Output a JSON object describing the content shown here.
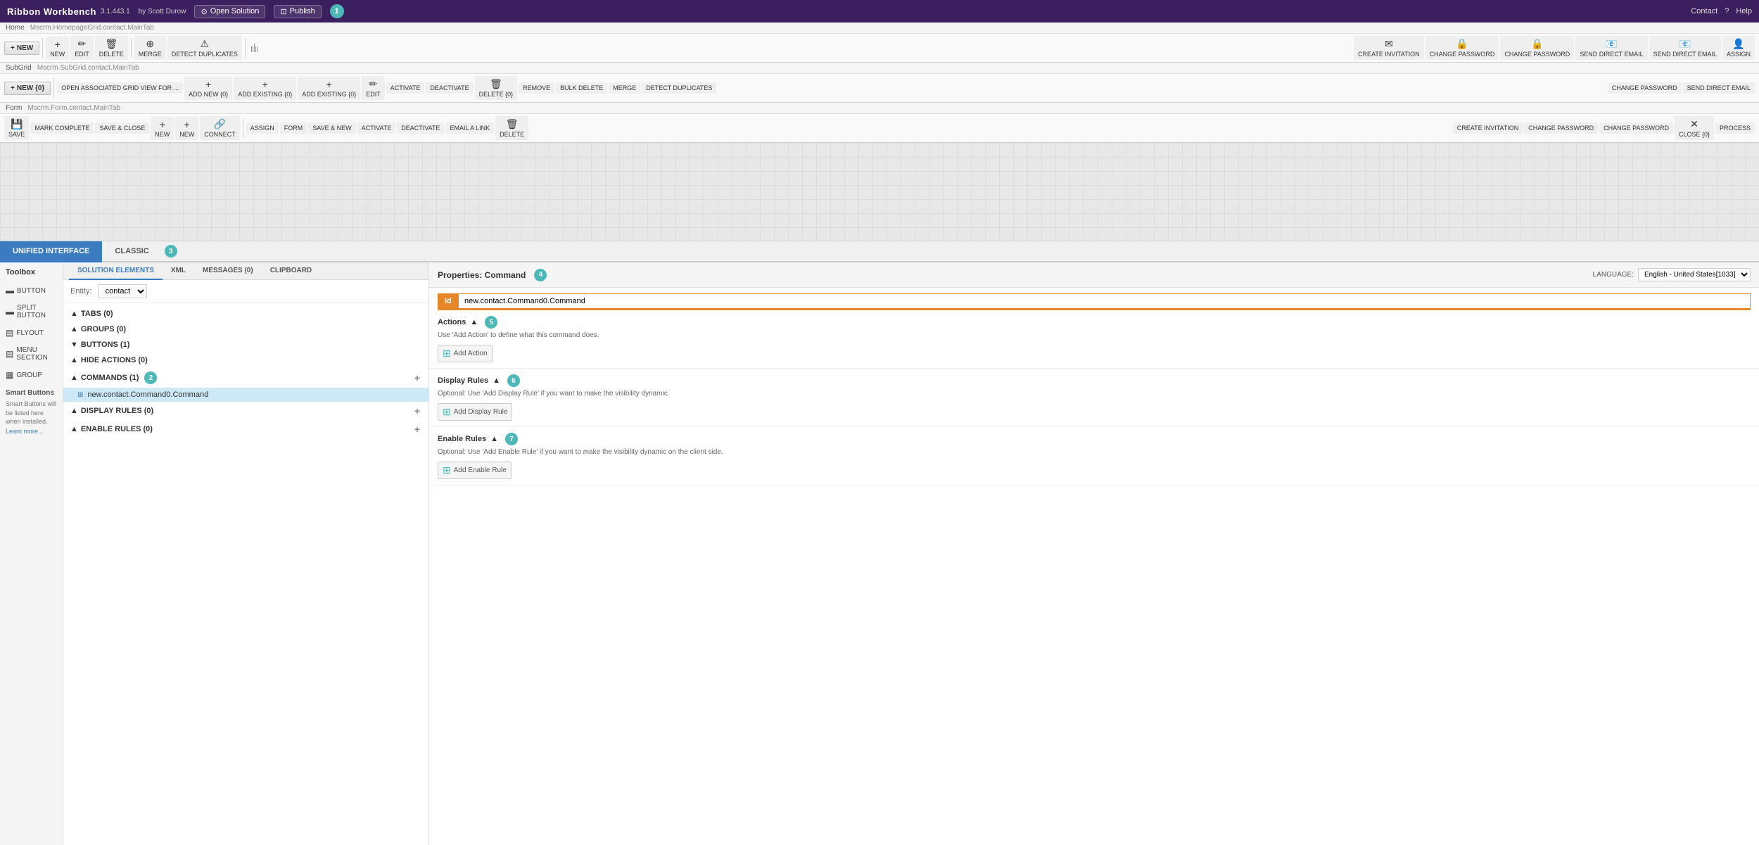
{
  "topbar": {
    "app_name": "Ribbon Workbench",
    "version": "3.1.443.1",
    "author": "by Scott Durow",
    "open_solution_label": "Open Solution",
    "publish_label": "Publish",
    "badge_num": "1",
    "contact_label": "Contact",
    "help_label": "Help"
  },
  "ribbon1": {
    "label": "Home",
    "path": "Mscrm.HomepageGrid.contact.MainTab",
    "buttons": [
      "NEW",
      "NEW",
      "EDIT",
      "DELETE",
      "MERGE",
      "DETECT DUPLICATES",
      "CREATE INVITATION",
      "CHANGE PASSWORD",
      "CHANGE PASSWORD",
      "SEND DIRECT EMAIL",
      "SEND DIRECT EMAIL",
      "ASSIGN"
    ]
  },
  "ribbon2": {
    "label": "SubGrid",
    "path": "Mscrm.SubGrid.contact.MainTab",
    "buttons": [
      "NEW {0}",
      "OPEN ASSOCIATED GRID VIEW FOR ...",
      "ADD NEW {0}",
      "ADD EXISTING {0}",
      "ADD EXISTING {0}",
      "EDIT",
      "ACTIVATE",
      "DEACTIVATE",
      "DELETE {0}",
      "REMOVE",
      "BULK DELETE",
      "MERGE",
      "DETECT DUPLICATES",
      "CHANGE PASSWORD",
      "SEND DIRECT EMAIL"
    ]
  },
  "ribbon3": {
    "label": "Form",
    "path": "Mscrm.Form.contact.MainTab",
    "buttons": [
      "SAVE",
      "MARK COMPLETE",
      "SAVE & CLOSE",
      "NEW",
      "NEW",
      "CONNECT",
      "ASSIGN",
      "FORM",
      "SAVE & NEW",
      "ACTIVATE",
      "DEACTIVATE",
      "EMAIL A LINK",
      "DELETE",
      "CREATE INVITATION",
      "CHANGE PASSWORD",
      "CHANGE PASSWORD",
      "CLOSE {0}",
      "PROCESS"
    ]
  },
  "tabs": {
    "unified_interface": "UNIFIED INTERFACE",
    "classic": "CLASSIC"
  },
  "left_panel": {
    "toolbox_title": "Toolbox",
    "items": [
      {
        "id": "button",
        "label": "BUTTON",
        "icon": "▬"
      },
      {
        "id": "split_button",
        "label": "SPLIT BUTTON",
        "icon": "▬▼"
      },
      {
        "id": "flyout",
        "label": "FLYOUT",
        "icon": "▤"
      },
      {
        "id": "menu_section",
        "label": "MENU SECTION",
        "icon": "▤▤"
      },
      {
        "id": "group",
        "label": "GROUP",
        "icon": "▦"
      }
    ],
    "smart_buttons_title": "Smart Buttons",
    "smart_buttons_desc": "Smart Buttons will be listed here when installed.",
    "learn_more": "Learn more..."
  },
  "middle_panel": {
    "sub_tabs": [
      {
        "id": "solution_elements",
        "label": "SOLUTION ELEMENTS",
        "active": true
      },
      {
        "id": "xml",
        "label": "XML"
      },
      {
        "id": "messages",
        "label": "MESSAGES (0)"
      },
      {
        "id": "clipboard",
        "label": "CLIPBOARD"
      }
    ],
    "entity_label": "Entity:",
    "entity_value": "contact",
    "tree": {
      "tabs": {
        "label": "TABS (0)",
        "count": 0
      },
      "groups": {
        "label": "GROUPS (0)",
        "count": 0
      },
      "buttons": {
        "label": "BUTTONS (1)",
        "count": 1
      },
      "hide_actions": {
        "label": "HIDE ACTIONS (0)",
        "count": 0
      },
      "commands": {
        "label": "COMMANDS (1)",
        "count": 1,
        "badge": "2"
      },
      "commands_item": "new.contact.Command0.Command",
      "display_rules": {
        "label": "DISPLAY RULES (0)",
        "count": 0
      },
      "enable_rules": {
        "label": "ENABLE RULES (0)",
        "count": 0
      }
    }
  },
  "properties_panel": {
    "title": "Properties: Command",
    "badge": "4",
    "language_label": "LANGUAGE:",
    "language_value": "English - United States[1033]",
    "id_label": "Id",
    "id_value": "new.contact.Command0.Command",
    "actions": {
      "title": "Actions",
      "badge": "5",
      "desc": "Use 'Add Action' to define what this command does.",
      "add_btn": "Add Action"
    },
    "display_rules": {
      "title": "Display Rules",
      "badge": "6",
      "desc": "Optional: Use 'Add Display Rule' if you want to make the visibility dynamic.",
      "add_btn": "Add Display Rule"
    },
    "enable_rules": {
      "title": "Enable Rules",
      "badge": "7",
      "desc": "Optional: Use 'Add Enable Rule' if you want to make the visibility dynamic on the client side.",
      "add_btn": "Add Enable Rule"
    }
  }
}
